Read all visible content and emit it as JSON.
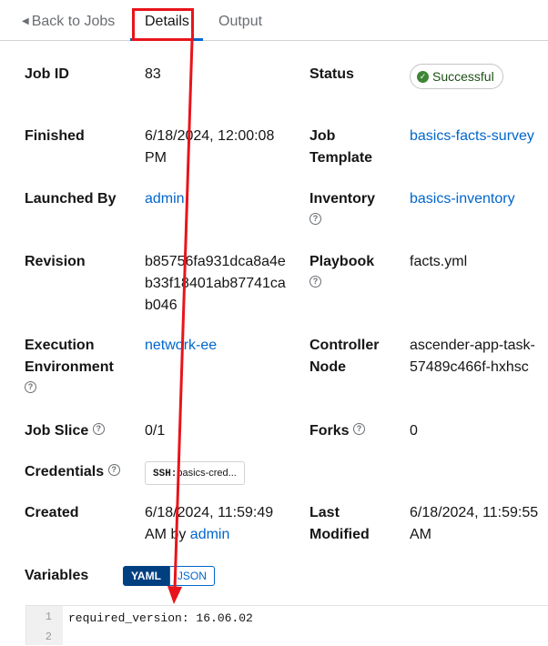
{
  "tabs": {
    "back": "Back to Jobs",
    "details": "Details",
    "output": "Output"
  },
  "fields": {
    "job_id": {
      "label": "Job ID",
      "value": "83"
    },
    "status": {
      "label": "Status",
      "value": "Successful"
    },
    "finished": {
      "label": "Finished",
      "value_line1": "6/18/2024, 12:00:08",
      "value_line2": "PM"
    },
    "job_template": {
      "label_line1": "Job",
      "label_line2": "Template",
      "value": "basics-facts-survey"
    },
    "launched_by": {
      "label": "Launched By",
      "value": "admin"
    },
    "inventory": {
      "label": "Inventory",
      "value": "basics-inventory"
    },
    "revision": {
      "label": "Revision",
      "value_line1": "b85756fa931dca8a4e",
      "value_line2": "b33f18401ab87741ca",
      "value_line3": "b046"
    },
    "playbook": {
      "label": "Playbook",
      "value": "facts.yml"
    },
    "execution_environment": {
      "label_line1": "Execution",
      "label_line2": "Environment",
      "value": "network-ee"
    },
    "controller_node": {
      "label_line1": "Controller",
      "label_line2": "Node",
      "value_line1": "ascender-app-task-",
      "value_line2": "57489c466f-hxhsc"
    },
    "job_slice": {
      "label": "Job Slice",
      "value": "0/1"
    },
    "forks": {
      "label": "Forks",
      "value": "0"
    },
    "credentials": {
      "label": "Credentials",
      "chip_type": "SSH:",
      "chip_value": "basics-cred..."
    },
    "created": {
      "label": "Created",
      "value_line1": "6/18/2024, 11:59:49",
      "value_line2_prefix": "AM by",
      "value_line2_link": "admin"
    },
    "last_modified": {
      "label_line1": "Last",
      "label_line2": "Modified",
      "value_line1": "6/18/2024, 11:59:55",
      "value_line2": "AM"
    },
    "variables": {
      "label": "Variables",
      "yaml": "YAML",
      "json": "JSON"
    }
  },
  "editor": {
    "lines": [
      "1",
      "2"
    ],
    "code": "required_version: 16.06.02"
  },
  "icons": {
    "help": "?",
    "check": "✓",
    "caret": "◀"
  },
  "colors": {
    "link": "#0066cc",
    "success": "#3e8635",
    "annotation": "#e8141b",
    "toggle_active": "#004080"
  }
}
